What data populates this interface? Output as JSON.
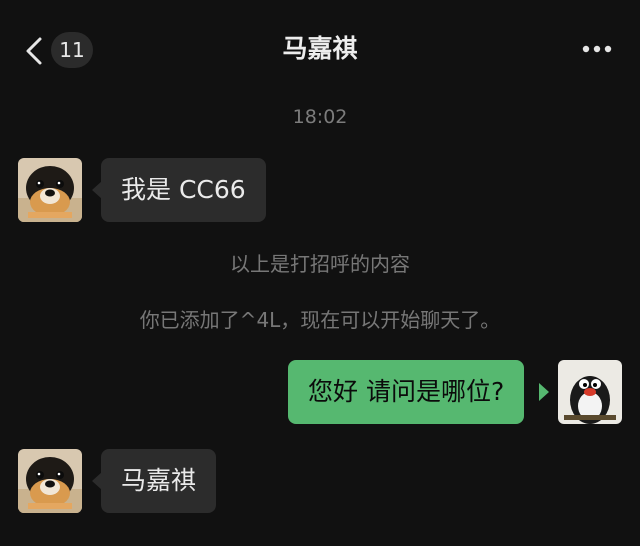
{
  "header": {
    "unread_count": "11",
    "title": "马嘉祺"
  },
  "messages": {
    "timestamp": "18:02",
    "incoming_1": "我是 CC66",
    "system_1": "以上是打招呼的内容",
    "system_2": "你已添加了^4L，现在可以开始聊天了。",
    "outgoing_1": "您好 请问是哪位?",
    "incoming_2": "马嘉祺"
  },
  "colors": {
    "background": "#111111",
    "incoming_bubble": "#2c2c2c",
    "outgoing_bubble": "#56b870",
    "system_text": "#777777"
  },
  "icons": {
    "back": "chevron-left-icon",
    "more": "more-dots-icon",
    "avatar_contact": "dog-avatar",
    "avatar_self": "penguin-avatar"
  }
}
